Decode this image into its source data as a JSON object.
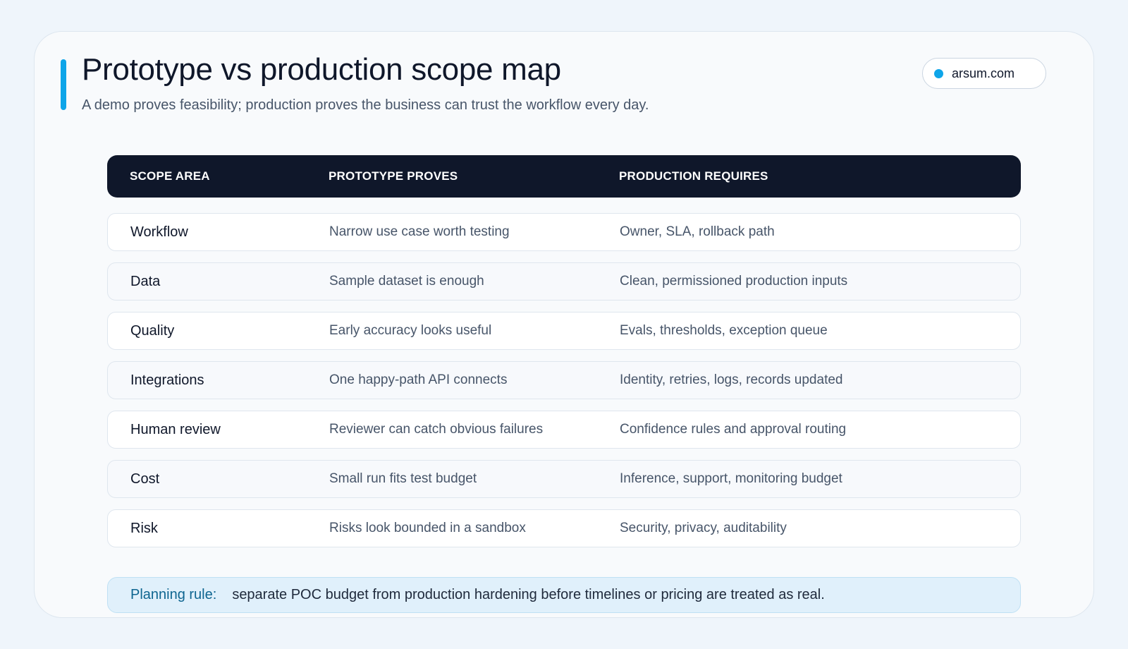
{
  "header": {
    "title": "Prototype vs production scope map",
    "subtitle": "A demo proves feasibility; production proves the business can trust the workflow every day.",
    "site": "arsum.com"
  },
  "table": {
    "columns": [
      "SCOPE AREA",
      "PROTOTYPE PROVES",
      "PRODUCTION REQUIRES"
    ],
    "rows": [
      [
        "Workflow",
        "Narrow use case worth testing",
        "Owner, SLA, rollback path"
      ],
      [
        "Data",
        "Sample dataset is enough",
        "Clean, permissioned production inputs"
      ],
      [
        "Quality",
        "Early accuracy looks useful",
        "Evals, thresholds, exception queue"
      ],
      [
        "Integrations",
        "One happy-path API connects",
        "Identity, retries, logs, records updated"
      ],
      [
        "Human review",
        "Reviewer can catch obvious failures",
        "Confidence rules and approval routing"
      ],
      [
        "Cost",
        "Small run fits test budget",
        "Inference, support, monitoring budget"
      ],
      [
        "Risk",
        "Risks look bounded in a sandbox",
        "Security, privacy, auditability"
      ]
    ]
  },
  "footer": {
    "label": "Planning rule:",
    "text": "separate POC budget from production hardening before timelines or pricing are treated as real."
  },
  "colors": {
    "accent": "#0ea5e9",
    "header_bg": "#0f172a",
    "rule_bg": "#e0f0fb"
  }
}
